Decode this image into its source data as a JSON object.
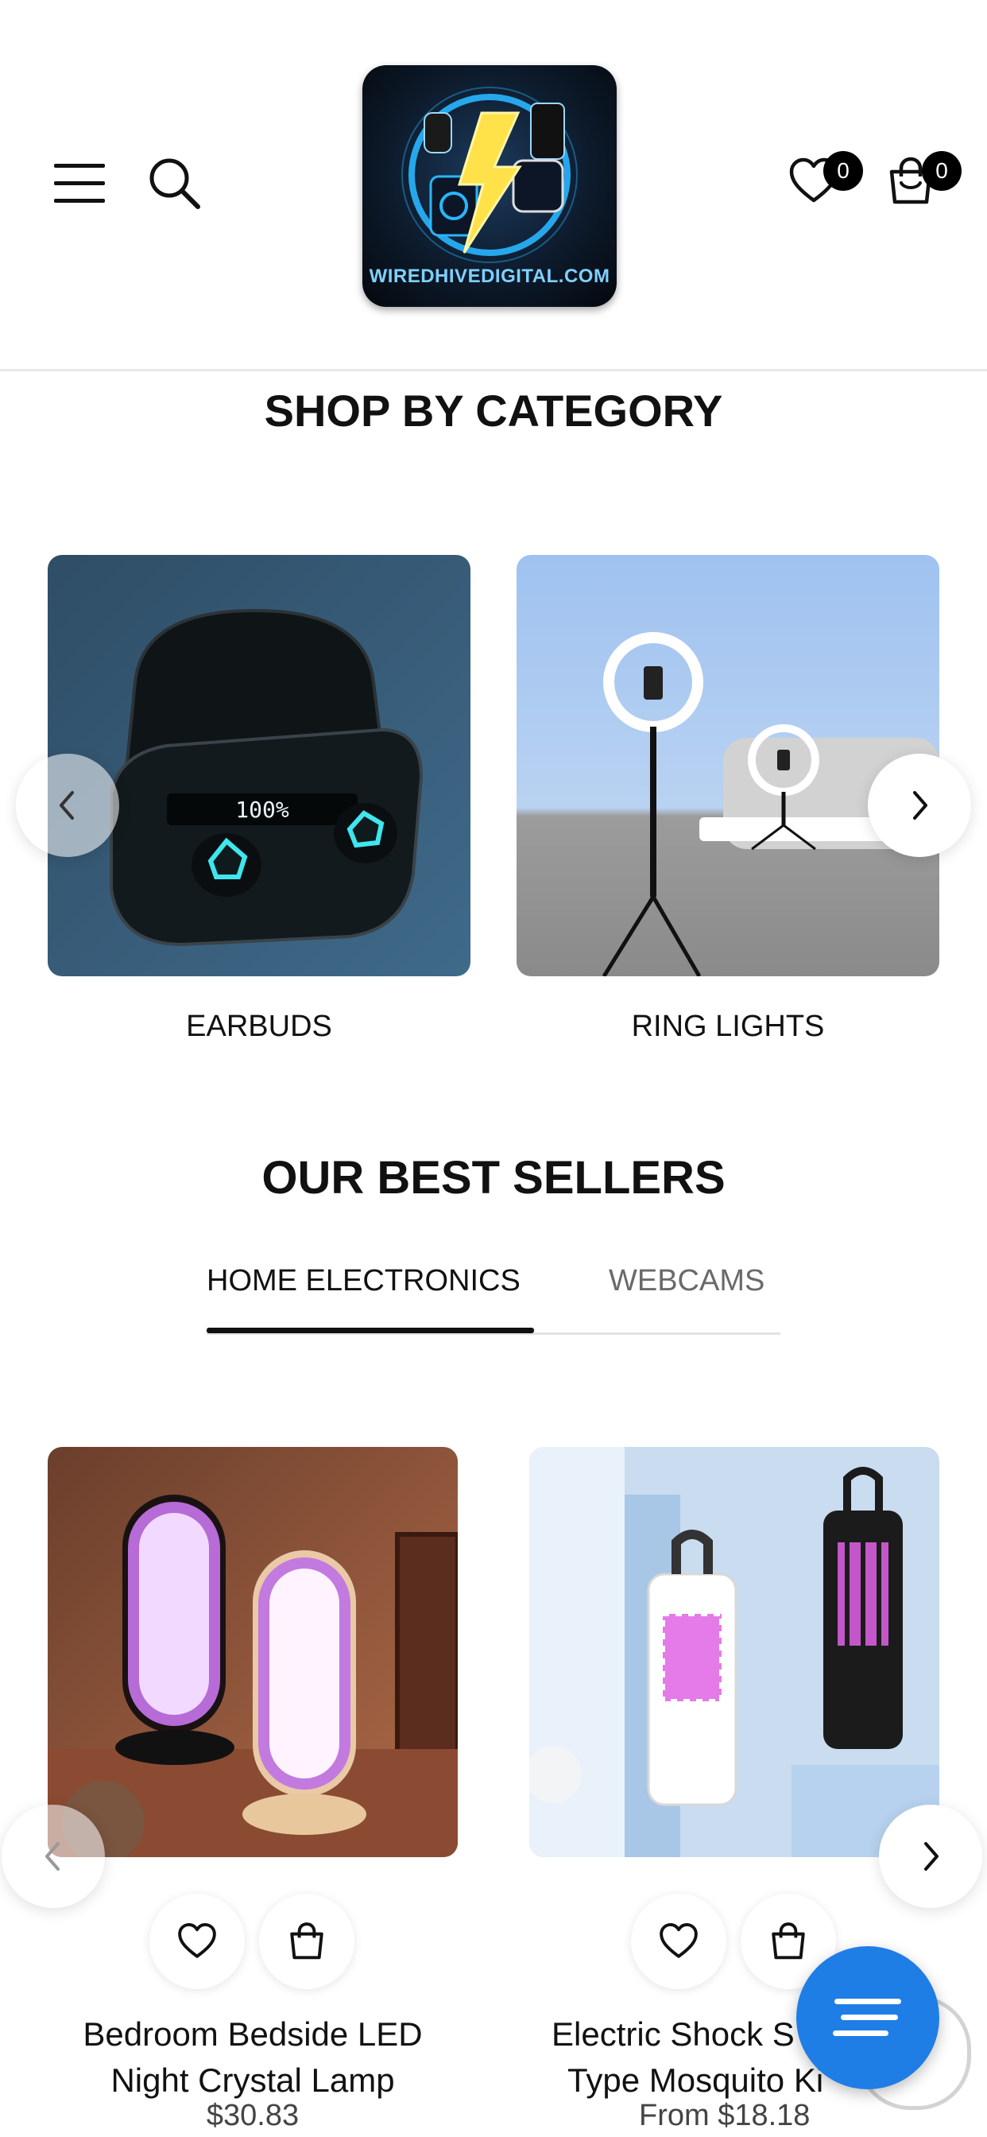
{
  "header": {
    "logo_text": "WIREDHIVEDIGITAL.COM",
    "wishlist_count": "0",
    "cart_count": "0"
  },
  "categories": {
    "title": "SHOP BY CATEGORY",
    "items": [
      {
        "label": "EARBUDS"
      },
      {
        "label": "RING LIGHTS"
      }
    ]
  },
  "best_sellers": {
    "title": "OUR BEST SELLERS",
    "tabs": [
      {
        "label": "HOME ELECTRONICS",
        "active": true
      },
      {
        "label": "WEBCAMS",
        "active": false
      }
    ],
    "products": [
      {
        "title_line1": "Bedroom Bedside LED",
        "title_line2": "Night Crystal Lamp",
        "price": "$30.83"
      },
      {
        "title_line1": "Electric Shock S",
        "title_line2": "Type Mosquito Ki",
        "price": "From $18.18"
      }
    ]
  },
  "colors": {
    "accent": "#1f7de6",
    "text": "#111111",
    "muted": "#6a6a6a"
  }
}
